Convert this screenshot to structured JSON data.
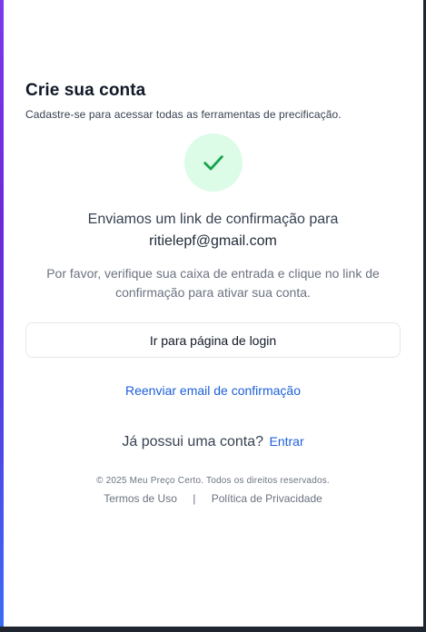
{
  "header": {
    "title": "Crie sua conta",
    "subtitle": "Cadastre-se para acessar todas as ferramentas de precificação."
  },
  "status_icon": {
    "icon": "checkmark-icon",
    "color": "#16a34a",
    "background": "#dcfce7"
  },
  "confirmation": {
    "message": "Enviamos um link de confirmação para",
    "email": "ritielepf@gmail.com",
    "instructions": "Por favor, verifique sua caixa de entrada e clique no link de confirmação para ativar sua conta."
  },
  "actions": {
    "login_button_label": "Ir para página de login",
    "resend_link_label": "Reenviar email de confirmação"
  },
  "account": {
    "prompt": "Já possui uma conta?",
    "signin_label": "Entrar"
  },
  "footer": {
    "copyright": "© 2025 Meu Preço Certo. Todos os direitos reservados.",
    "terms_label": "Termos de Uso",
    "separator": "|",
    "privacy_label": "Política de Privacidade"
  },
  "colors": {
    "accent": "#1d5fd8",
    "success": "#16a34a"
  }
}
